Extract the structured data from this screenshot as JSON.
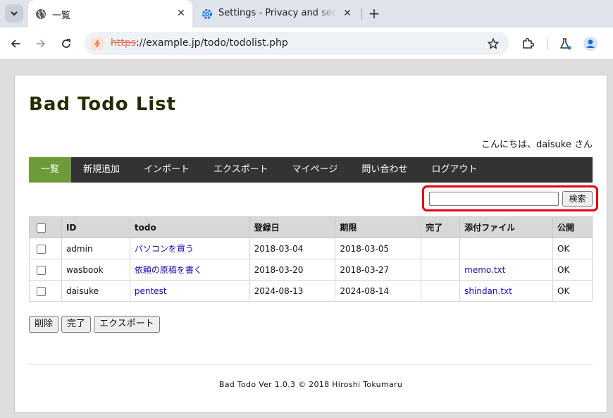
{
  "browser": {
    "tabs": [
      {
        "title": "一覧",
        "icon": "globe-icon",
        "active": true
      },
      {
        "title": "Settings - Privacy and security",
        "icon": "gear-icon",
        "active": false
      }
    ],
    "url_scheme": "https",
    "url_rest": "://example.jp/todo/todolist.php"
  },
  "page": {
    "title": "Bad Todo List",
    "greeting": "こんにちは、daisuke さん",
    "nav": [
      "一覧",
      "新規追加",
      "インポート",
      "エクスポート",
      "マイページ",
      "問い合わせ",
      "ログアウト"
    ],
    "search": {
      "value": "",
      "button": "検索"
    },
    "table": {
      "headers": [
        "ID",
        "todo",
        "登録日",
        "期限",
        "完了",
        "添付ファイル",
        "公開"
      ],
      "rows": [
        {
          "id": "admin",
          "todo": "パソコンを買う",
          "registered": "2018-03-04",
          "due": "2018-03-05",
          "done": "",
          "attachment": "",
          "public": "OK"
        },
        {
          "id": "wasbook",
          "todo": "依頼の原稿を書く",
          "registered": "2018-03-20",
          "due": "2018-03-27",
          "done": "",
          "attachment": "memo.txt",
          "public": "OK"
        },
        {
          "id": "daisuke",
          "todo": "pentest",
          "registered": "2024-08-13",
          "due": "2024-08-14",
          "done": "",
          "attachment": "shindan.txt",
          "public": "OK"
        }
      ]
    },
    "actions": [
      "削除",
      "完了",
      "エクスポート"
    ],
    "footer": "Bad Todo Ver 1.0.3 © 2018 Hiroshi Tokumaru"
  },
  "colors": {
    "nav_active": "#6f9a3c",
    "nav_bg": "#333333",
    "highlight": "#e2000f",
    "link": "#1a0dab"
  }
}
